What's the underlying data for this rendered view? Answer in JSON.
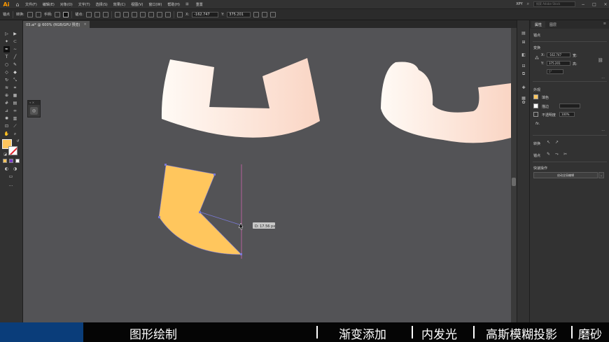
{
  "menubar": {
    "logo": "Ai",
    "items": [
      "文件(F)",
      "编辑(E)",
      "对象(O)",
      "文字(T)",
      "选择(S)",
      "效果(C)",
      "视图(V)",
      "窗口(W)",
      "帮助(H)"
    ],
    "layout_label": "重置",
    "user": "XPY",
    "search_placeholder": "搜索 Adobe Stock"
  },
  "controlbar": {
    "label": "锚点",
    "convert": "转换:",
    "handles": "手柄:",
    "anchor": "锚点:",
    "x_label": "X:",
    "x_value": "-162.747",
    "y_label": "Y:",
    "y_value": "375.201"
  },
  "document_tab": {
    "title": "03.ai* @ 600% (RGB/GPU 预览)",
    "close": "×"
  },
  "properties_panel": {
    "tabs": [
      "属性",
      "图层"
    ],
    "anchor_title": "锚点",
    "transform_title": "变换",
    "x_label": "X:",
    "x_value": "-162.747",
    "y_label": "Y:",
    "y_value": "375.201",
    "w_label": "宽:",
    "h_label": "高:",
    "angle_value": "0°",
    "appearance_title": "外观",
    "fill_label": "填色",
    "stroke_label": "描边",
    "opacity_label": "不透明度",
    "opacity_value": "100%",
    "fx_label": "fx.",
    "convert_label": "转换",
    "anchor_label": "锚点",
    "quick_actions_title": "快速操作",
    "quick_action_button": "启动全局编辑"
  },
  "canvas": {
    "distance_tooltip": "D: 17.56 px",
    "colors": {
      "canvas_bg": "#535356",
      "shape_fill": "#ffc65d",
      "gradient_start": "#fffaf5",
      "gradient_end": "#fad5c4",
      "guide": "#cc66aa",
      "path": "#7a7ad8"
    }
  },
  "toolbar": {
    "fill_color": "#ffc65d",
    "more": "···"
  },
  "bottom_bar": {
    "items": [
      "图形绘制",
      "渐变添加",
      "内发光",
      "高斯模糊投影",
      "磨砂"
    ],
    "accent": "#0a3d7a"
  }
}
